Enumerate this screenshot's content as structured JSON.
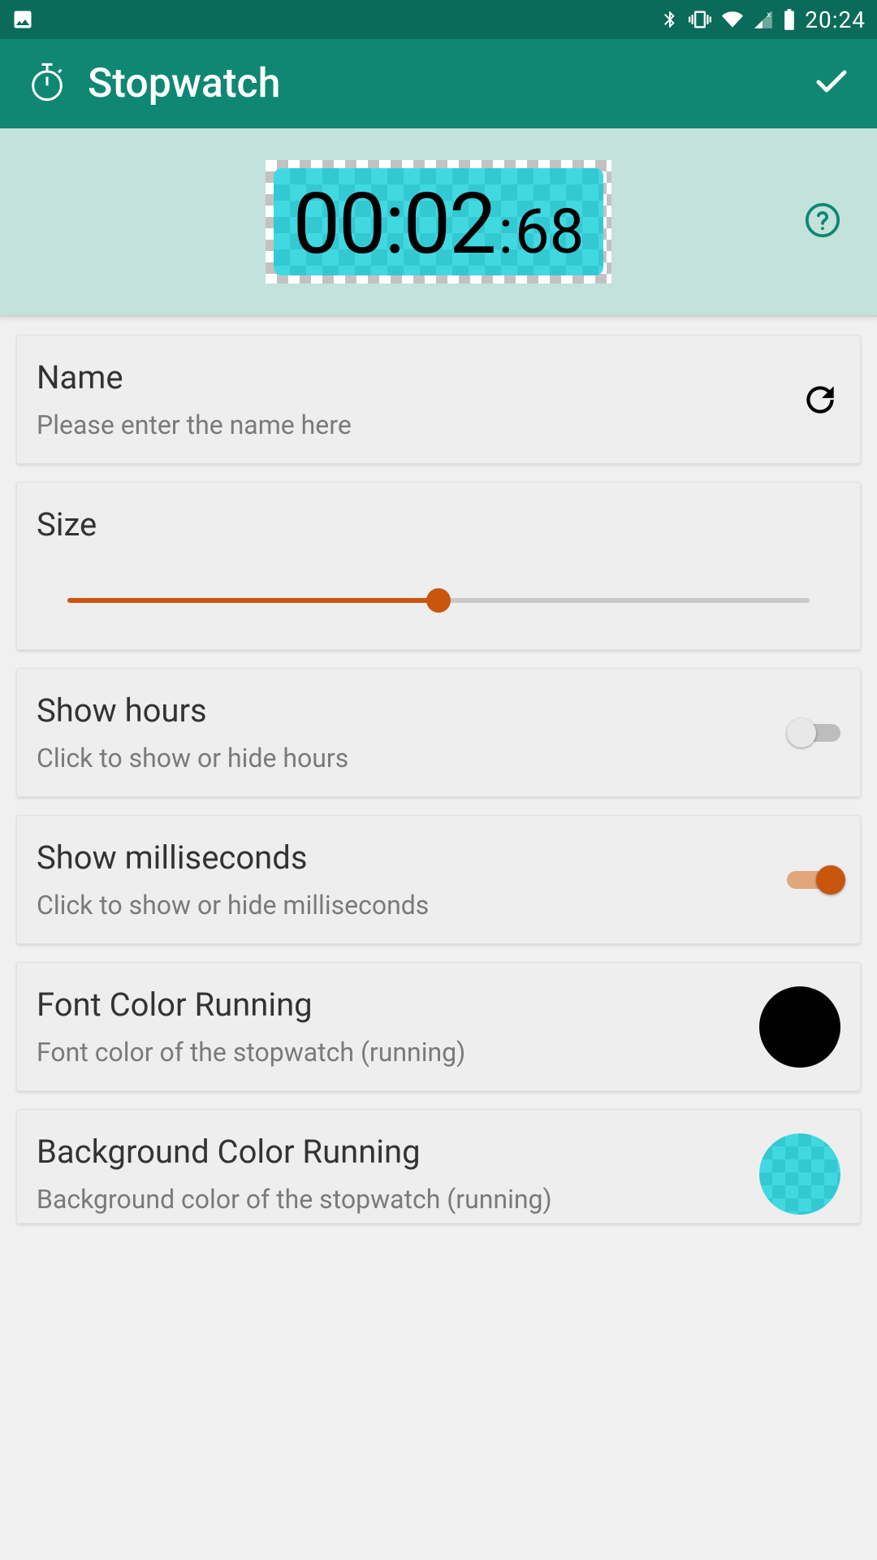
{
  "status": {
    "clock": "20:24"
  },
  "appbar": {
    "title": "Stopwatch"
  },
  "preview": {
    "time_main": "00:02",
    "time_frac": "68"
  },
  "cards": {
    "name": {
      "title": "Name",
      "placeholder": "Please enter the name here"
    },
    "size": {
      "title": "Size",
      "value_pct": 50
    },
    "show_hours": {
      "title": "Show hours",
      "subtitle": "Click to show or hide hours",
      "enabled": false
    },
    "show_ms": {
      "title": "Show milliseconds",
      "subtitle": "Click to show or hide milliseconds",
      "enabled": true
    },
    "font_color_running": {
      "title": "Font Color Running",
      "subtitle": "Font color of the stopwatch (running)",
      "color": "#000000"
    },
    "bg_color_running": {
      "title": "Background Color Running",
      "subtitle": "Background color of the stopwatch (running)",
      "color": "#41d9e1"
    }
  },
  "colors": {
    "primary": "#0f8773",
    "primary_dark": "#0b6b5a",
    "accent": "#c9560e"
  }
}
